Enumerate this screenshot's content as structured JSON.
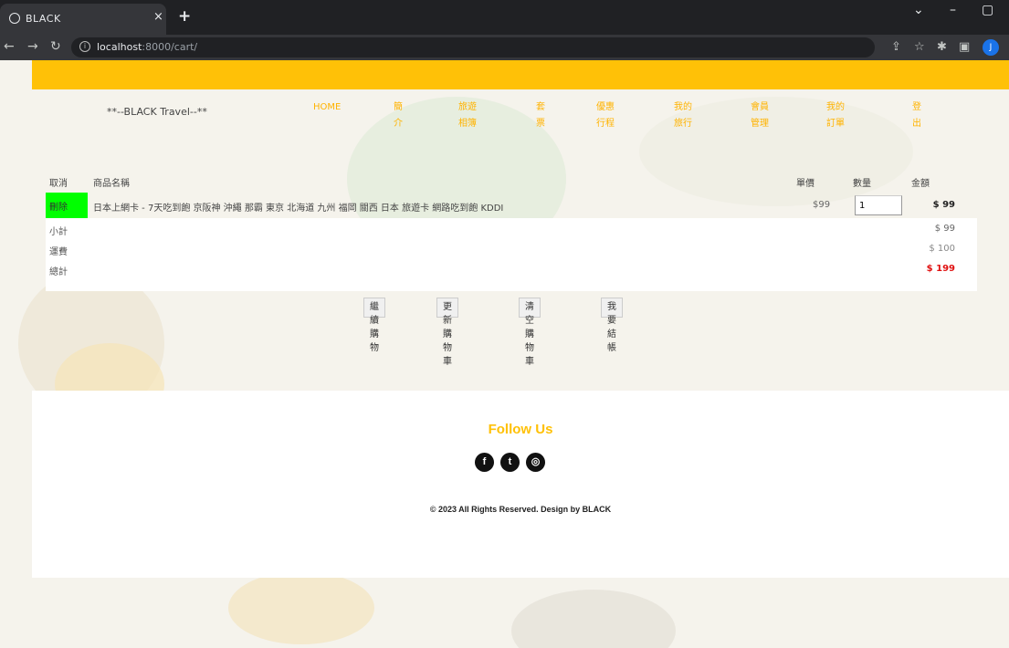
{
  "browser": {
    "tab_title": "BLACK",
    "tab_close": "×",
    "new_tab": "+",
    "url_host": "localhost",
    "url_path": ":8000/cart/",
    "profile_initial": "J",
    "window_controls": {
      "collapse": "⌄",
      "minimize": "–",
      "maximize": "▢"
    }
  },
  "header": {
    "brand": "**--BLACK Travel--**",
    "menu": [
      {
        "label": "HOME",
        "line2": ""
      },
      {
        "label": "簡",
        "line2": "介"
      },
      {
        "label": "旅遊",
        "line2": "相簿"
      },
      {
        "label": "套",
        "line2": "票"
      },
      {
        "label": "優惠",
        "line2": "行程"
      },
      {
        "label": "我的",
        "line2": "旅行"
      },
      {
        "label": "會員",
        "line2": "管理"
      },
      {
        "label": "我的",
        "line2": "訂單"
      },
      {
        "label": "登",
        "line2": "出"
      }
    ]
  },
  "cart": {
    "headers": {
      "cancel": "取消",
      "name": "商品名稱",
      "price": "單價",
      "qty": "數量",
      "amount": "金額"
    },
    "items": [
      {
        "delete_label": "刪除",
        "name": "日本上網卡 - 7天吃到飽 京阪神 沖繩 那霸 東京 北海道 九州 福岡 關西 日本 旅遊卡 網路吃到飽 KDDI",
        "price": "$99",
        "qty": "1",
        "amount": "$ 99"
      }
    ],
    "summary": {
      "subtotal_label": "小計",
      "subtotal": "$ 99",
      "shipping_label": "運費",
      "shipping": "$ 100",
      "total_label": "總計",
      "total": "$ 199"
    },
    "actions": [
      "繼續購物",
      "更新購物車",
      "清空購物車",
      "我要結帳"
    ]
  },
  "footer": {
    "follow": "Follow Us",
    "socials": [
      "facebook",
      "twitter",
      "instagram"
    ],
    "copyright": "© 2023 All Rights Reserved. Design by BLACK"
  },
  "colors": {
    "accent": "#ffc107",
    "delete": "#00ff00",
    "total": "#e01010"
  }
}
